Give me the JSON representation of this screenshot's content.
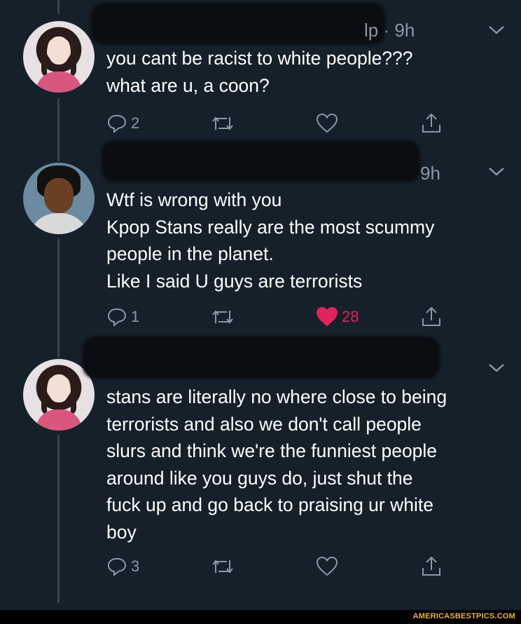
{
  "tweets": [
    {
      "time": "9h",
      "name_fragment": "lp",
      "text": "you cant be racist to white people???\nwhat are u, a coon?",
      "replies": "2",
      "retweets": "",
      "likes": "",
      "liked": false
    },
    {
      "time": "9h",
      "text": "Wtf is wrong with you\nKpop Stans really are the most scummy\npeople in the planet.\nLike I said U guys are terrorists",
      "replies": "1",
      "retweets": "",
      "likes": "28",
      "liked": true
    },
    {
      "time": "",
      "text": "stans are literally no where close to being\nterrorists and also we don't call people\nslurs and think we're the funniest people\naround like you guys do, just shut the\nfuck up and go back to praising ur white\nboy",
      "replies": "3",
      "retweets": "",
      "likes": "",
      "liked": false
    }
  ],
  "watermark": "AMERICASBESTPICS.COM",
  "colors": {
    "background": "#15202b",
    "muted": "#8b98a5",
    "like": "#e0245e",
    "thread_line": "#38444d"
  },
  "icons": {
    "reply": "reply-icon",
    "retweet": "retweet-icon",
    "like": "heart-icon",
    "share": "share-icon",
    "menu": "chevron-down-icon"
  }
}
